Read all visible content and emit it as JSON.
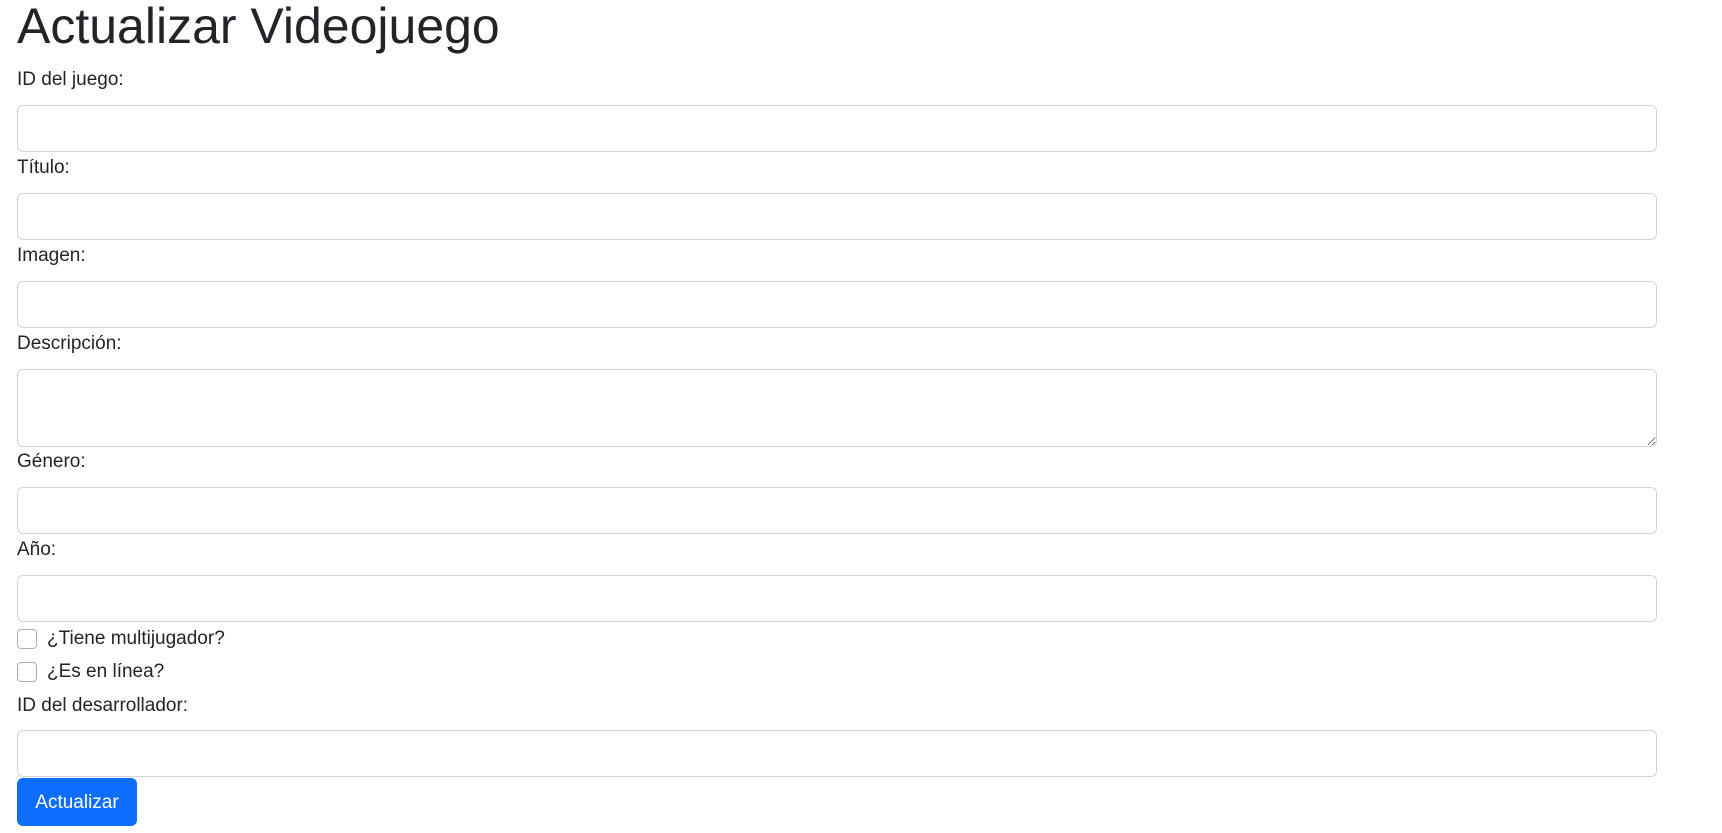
{
  "page": {
    "title": "Actualizar Videojuego"
  },
  "form": {
    "fields": {
      "game_id": {
        "label": "ID del juego:",
        "value": "",
        "placeholder": ""
      },
      "title": {
        "label": "Título:",
        "value": "",
        "placeholder": ""
      },
      "image": {
        "label": "Imagen:",
        "value": "",
        "placeholder": ""
      },
      "description": {
        "label": "Descripción:",
        "value": "",
        "placeholder": ""
      },
      "genre": {
        "label": "Género:",
        "value": "",
        "placeholder": ""
      },
      "year": {
        "label": "Año:",
        "value": "",
        "placeholder": ""
      },
      "developer_id": {
        "label": "ID del desarrollador:",
        "value": "",
        "placeholder": ""
      }
    },
    "checkboxes": {
      "multiplayer": {
        "label": "¿Tiene multijugador?",
        "checked": false
      },
      "online": {
        "label": "¿Es en línea?",
        "checked": false
      }
    },
    "submit_label": "Actualizar"
  },
  "colors": {
    "primary": "#0d6efd",
    "text": "#212529",
    "border": "#ced4da"
  }
}
